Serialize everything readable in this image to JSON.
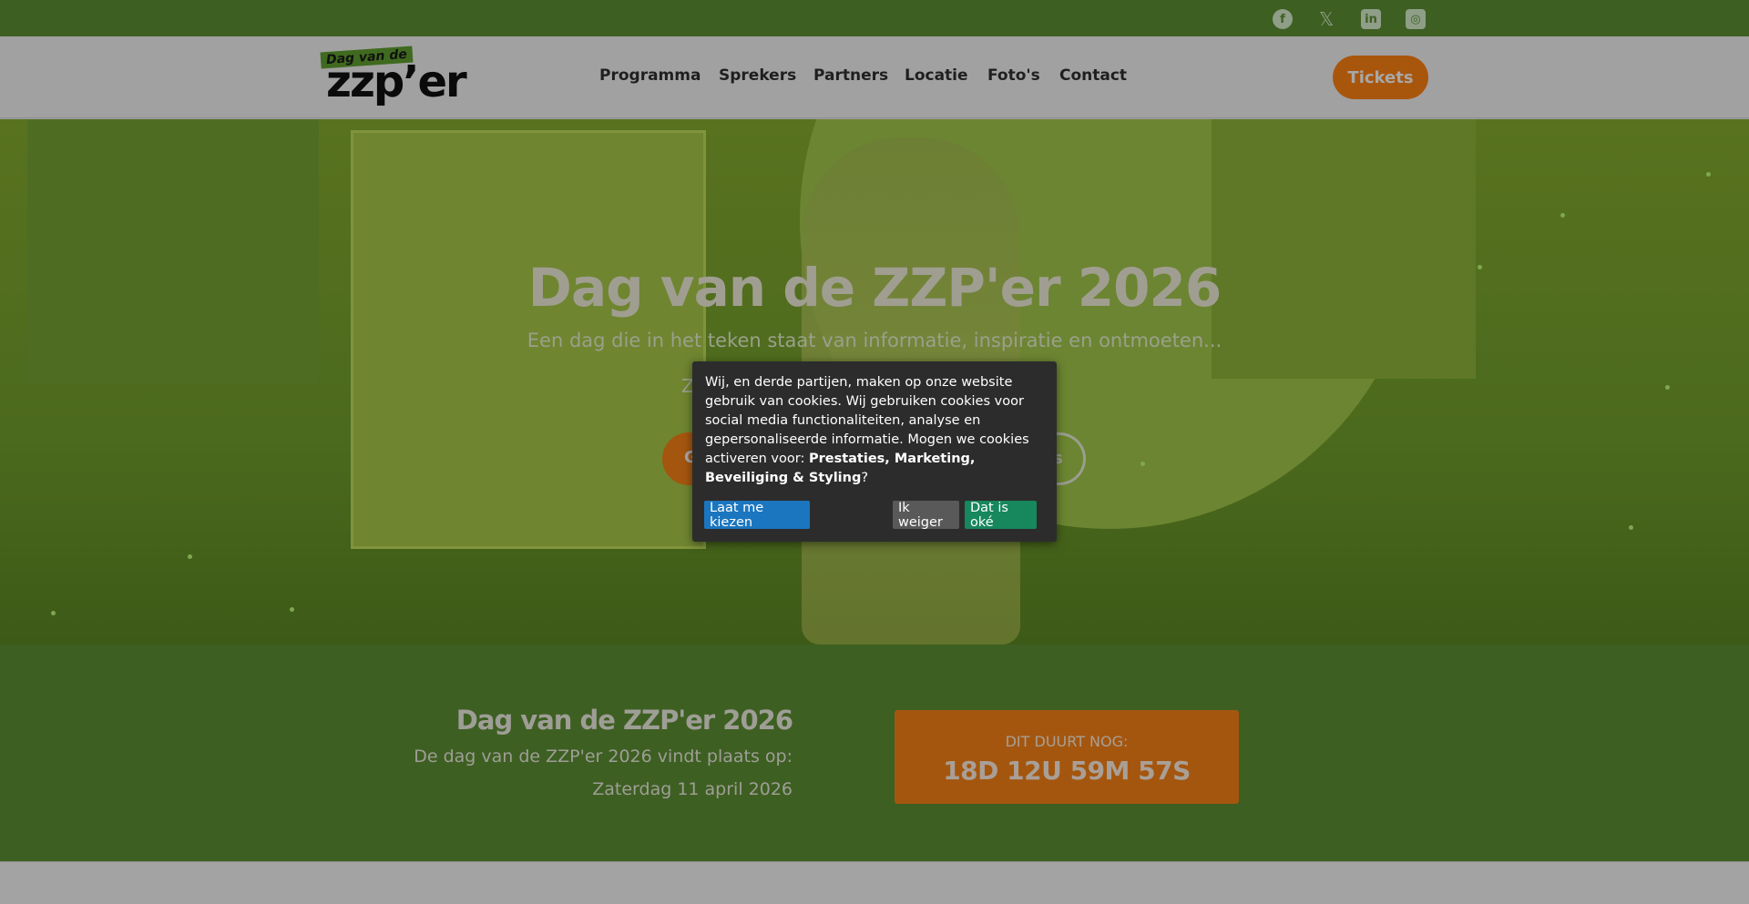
{
  "social": {
    "facebook": "facebook-icon",
    "x": "x-twitter-icon",
    "linkedin": "linkedin-icon",
    "instagram": "instagram-icon"
  },
  "header": {
    "logo_top": "Dag van de",
    "logo_main": "zzp’er",
    "nav": [
      "Programma",
      "Sprekers",
      "Partners",
      "Locatie",
      "Foto's",
      "Contact"
    ],
    "tickets_label": "Tickets"
  },
  "hero": {
    "title": "Dag van de ZZP'er 2026",
    "subtitle": "Een dag die in het teken staat van informatie, inspiratie en ontmoeten...",
    "sub2_visible_start": "Z",
    "sub2_visible_end": "k",
    "button_left_visible": "G",
    "button_right_visible": "s"
  },
  "cookie": {
    "text_before": "Wij, en derde partijen, maken op onze website gebruik van cookies. Wij gebruiken cookies voor social media functionaliteiten, analyse en gepersonaliseerde informatie. Mogen we cookies activeren voor: ",
    "text_bold": "Prestaties, Marketing, Beveiliging & Styling",
    "text_after": "?",
    "choose_label": "Laat me kiezen",
    "refuse_label": "Ik weiger",
    "ok_label": "Dat is oké"
  },
  "countdown": {
    "title": "Dag van de ZZP'er 2026",
    "line1": "De dag van de ZZP'er 2026 vindt plaats op:",
    "line2": "Zaterdag 11 april 2026",
    "box_label": "DIT DUURT NOG:",
    "box_value": "18D 12U 59M 57S"
  },
  "colors": {
    "green_bar": "#3e5f22",
    "orange": "#a4560f",
    "cookie_bg": "#2c2c2c",
    "btn_blue": "#1b76bf",
    "btn_grey": "#595959",
    "btn_green": "#17875e"
  }
}
